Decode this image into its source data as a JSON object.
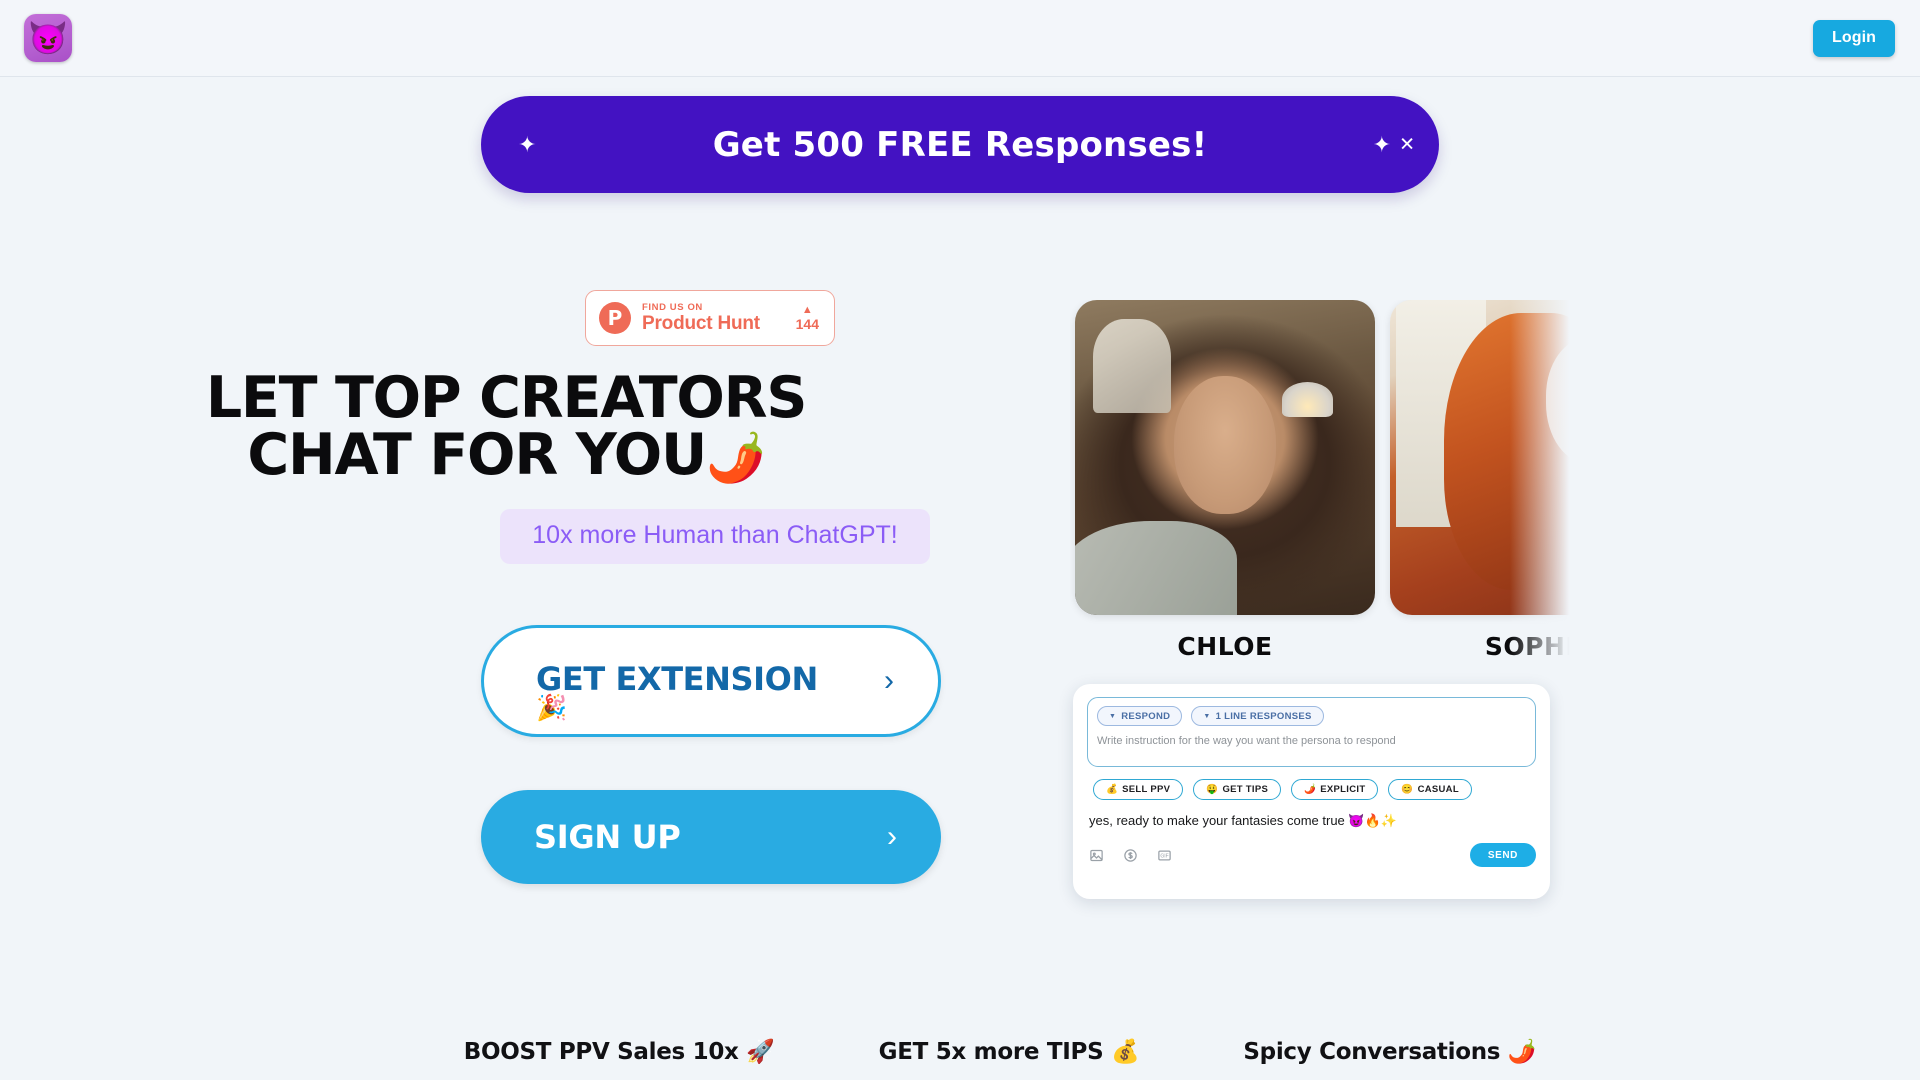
{
  "header": {
    "logo_icon": "devil-emoji-logo",
    "logo_glyph": "😈",
    "login_label": "Login"
  },
  "banner": {
    "title": "Get 500 FREE Responses!",
    "sparkle_left": "✦",
    "sparkle_right": "✦",
    "close_glyph": "✕",
    "background_color": "#4312c2"
  },
  "hero": {
    "product_hunt": {
      "icon_letter": "P",
      "find_us_on": "FIND US ON",
      "name": "Product Hunt",
      "upvote_arrow": "▲",
      "count": "144"
    },
    "headline_line1": "LET TOP CREATORS",
    "headline_line2": "CHAT FOR YOU",
    "headline_emoji": "🌶️",
    "subtitle": "10x more Human than ChatGPT!",
    "cta_primary": {
      "label": "GET EXTENSION",
      "emoji": "🎉",
      "chevron": "›"
    },
    "cta_secondary": {
      "label": "SIGN UP",
      "chevron": "›"
    }
  },
  "personas": [
    {
      "name": "CHLOE"
    },
    {
      "name": "SOPHIA"
    }
  ],
  "chat_widget": {
    "dropdowns": [
      {
        "label": "RESPOND",
        "caret": "▼"
      },
      {
        "label": "1 LINE RESPONSES",
        "caret": "▼"
      }
    ],
    "instruction_placeholder": "Write instruction for the way you want the persona to respond",
    "tags": [
      {
        "emoji": "💰",
        "label": "SELL PPV"
      },
      {
        "emoji": "🤑",
        "label": "GET TIPS"
      },
      {
        "emoji": "🌶️",
        "label": "EXPLICIT"
      },
      {
        "emoji": "😊",
        "label": "CASUAL"
      }
    ],
    "reply_text": "yes, ready to make your fantasies come true 😈🔥✨",
    "footer_icons": [
      "image-icon",
      "dollar-icon",
      "gif-icon"
    ],
    "send_label": "SEND"
  },
  "features": [
    "BOOST PPV Sales 10x 🚀",
    "GET 5x more TIPS 💰",
    "Spicy Conversations 🌶️"
  ],
  "colors": {
    "page_background": "#f1f5f9",
    "accent_cyan": "#29abe2",
    "accent_purple": "#4312c2",
    "subtitle_purple": "#8b5cf6",
    "product_hunt_red": "#ef6b57"
  }
}
